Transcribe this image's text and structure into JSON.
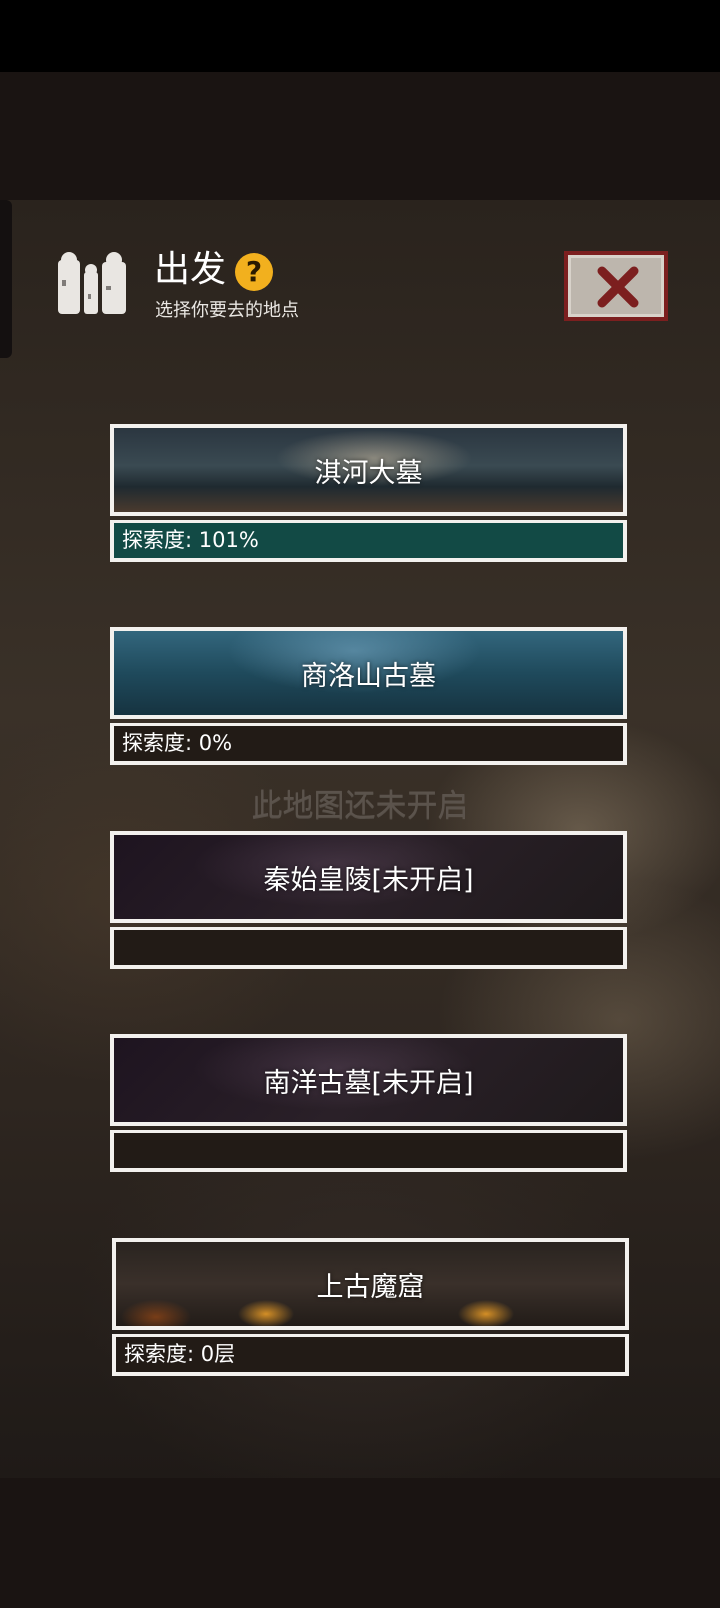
{
  "header": {
    "title": "出发",
    "subtitle": "选择你要去的地点",
    "help_glyph": "?"
  },
  "locked_notice": "此地图还未开启",
  "locations": [
    {
      "name": "淇河大墓",
      "progress": "探索度: 101%",
      "locked": false
    },
    {
      "name": "商洛山古墓",
      "progress": "探索度: 0%",
      "locked": false
    },
    {
      "name": "秦始皇陵[未开启]",
      "progress": "",
      "locked": true
    },
    {
      "name": "南洋古墓[未开启]",
      "progress": "",
      "locked": true
    },
    {
      "name": "上古魔窟",
      "progress": "探索度: 0层",
      "locked": false
    }
  ],
  "colors": {
    "progress_highlight": "#124a45",
    "help_icon": "#f2b01e",
    "close_frame": "#7c1f1f"
  },
  "icons": {
    "header": "crew-silhouette-icon",
    "help": "question-mark-icon",
    "close": "close-x-icon"
  }
}
